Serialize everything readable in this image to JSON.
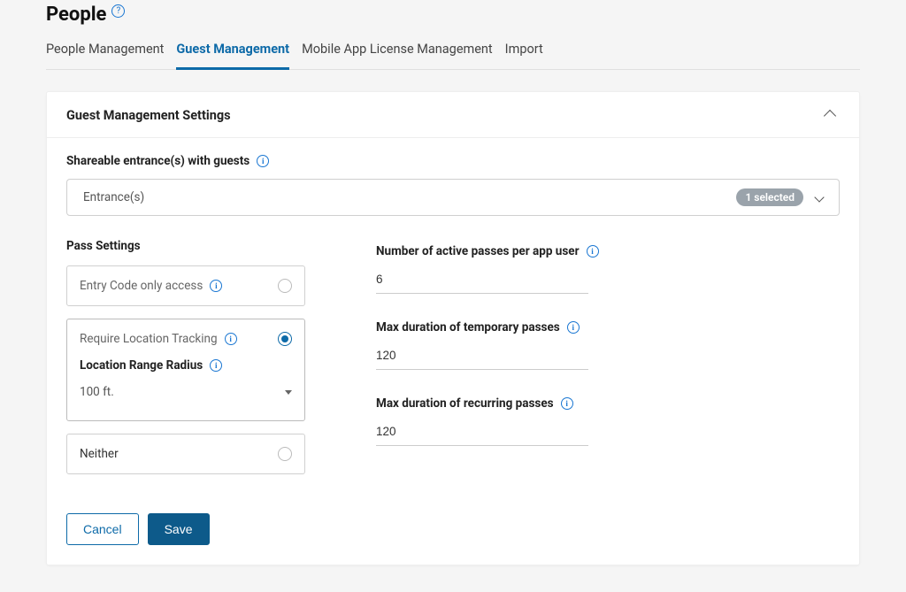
{
  "page_title": "People",
  "tabs": [
    "People Management",
    "Guest Management",
    "Mobile App License Management",
    "Import"
  ],
  "active_tab_index": 1,
  "card_title": "Guest Management Settings",
  "shareable_label": "Shareable entrance(s) with guests",
  "entrance_placeholder": "Entrance(s)",
  "entrance_badge": "1 selected",
  "pass_settings_label": "Pass Settings",
  "radio_options": {
    "entry_code": "Entry Code only access",
    "location_tracking": "Require Location Tracking",
    "neither": "Neither"
  },
  "selected_radio": "location_tracking",
  "location_range_label": "Location Range Radius",
  "location_range_value": "100 ft.",
  "fields": {
    "active_passes": {
      "label": "Number of active passes per app user",
      "value": "6"
    },
    "max_temp": {
      "label": "Max duration of temporary passes",
      "value": "120"
    },
    "max_recurring": {
      "label": "Max duration of recurring passes",
      "value": "120"
    }
  },
  "buttons": {
    "cancel": "Cancel",
    "save": "Save"
  }
}
